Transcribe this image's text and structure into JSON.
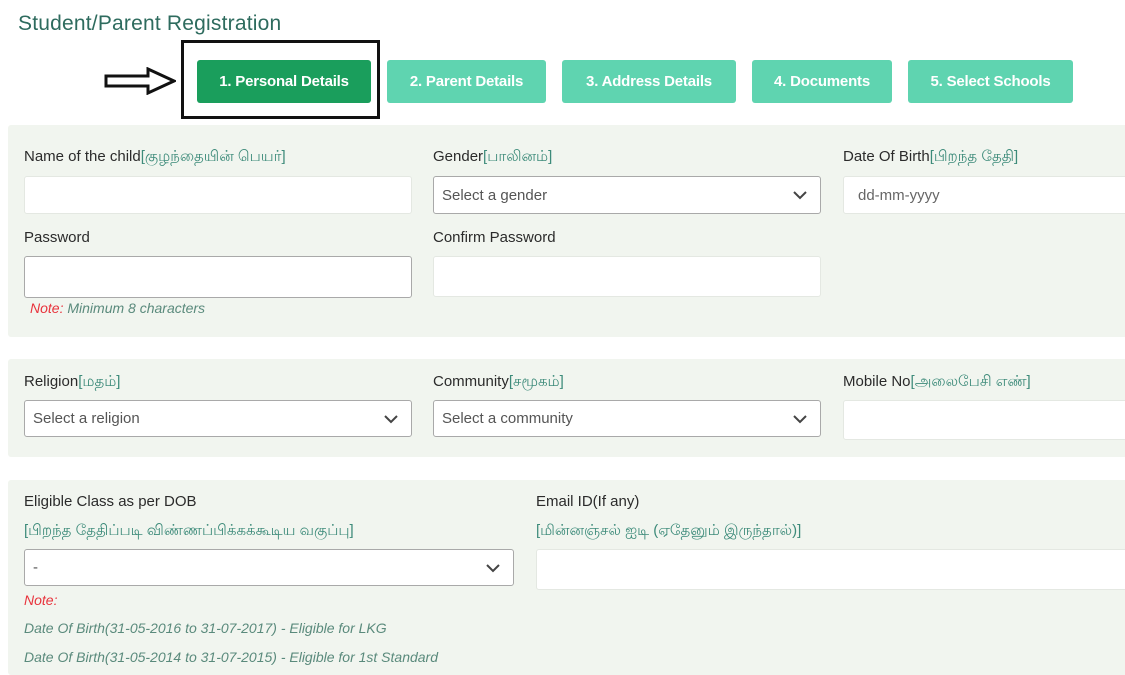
{
  "page": {
    "title": "Student/Parent Registration"
  },
  "annotation": {
    "arrow_icon": "right-arrow-outline",
    "highlight": "box-around-step-1"
  },
  "steps": [
    {
      "label": "1. Personal Details",
      "active": true
    },
    {
      "label": "2. Parent Details",
      "active": false
    },
    {
      "label": "3. Address Details",
      "active": false
    },
    {
      "label": "4. Documents",
      "active": false
    },
    {
      "label": "5. Select Schools",
      "active": false
    }
  ],
  "colors": {
    "active_step": "#1a9e5c",
    "inactive_step": "#5fd4b0",
    "title": "#2e6b5e",
    "tamil_text": "#3d8b7a",
    "note_red": "#e8333c",
    "panel_bg": "#f1f5ef"
  },
  "section1": {
    "child_name": {
      "label": "Name of the child",
      "tamil": "[குழந்தையின் பெயர்]",
      "value": ""
    },
    "gender": {
      "label": "Gender",
      "tamil": "[பாலினம்]",
      "selected": "Select a gender"
    },
    "dob": {
      "label": "Date Of Birth",
      "tamil": "[பிறந்த தேதி]",
      "placeholder": "dd-mm-yyyy"
    },
    "password": {
      "label": "Password",
      "value": "",
      "note_prefix": "Note:",
      "note_text": " Minimum 8 characters"
    },
    "confirm_password": {
      "label": "Confirm Password",
      "value": ""
    }
  },
  "section2": {
    "religion": {
      "label": "Religion",
      "tamil": "[மதம்]",
      "selected": "Select a religion"
    },
    "community": {
      "label": "Community",
      "tamil": "[சமூகம்]",
      "selected": "Select a community"
    },
    "mobile": {
      "label": "Mobile No",
      "tamil": "[அலைபேசி எண்]",
      "value": ""
    }
  },
  "section3": {
    "eligible_class": {
      "label": "Eligible Class as per DOB",
      "tamil": "[பிறந்த தேதிப்படி விண்ணப்பிக்கக்கூடிய வகுப்பு]",
      "selected": "-",
      "note_prefix": "Note:",
      "notes": [
        "Date Of Birth(31-05-2016 to 31-07-2017) - Eligible for LKG",
        "Date Of Birth(31-05-2014 to 31-07-2015) - Eligible for 1st Standard"
      ]
    },
    "email": {
      "label": "Email ID(If any)",
      "tamil": "[மின்னஞ்சல் ஐடி (ஏதேனும் இருந்தால்)]",
      "value": ""
    }
  }
}
